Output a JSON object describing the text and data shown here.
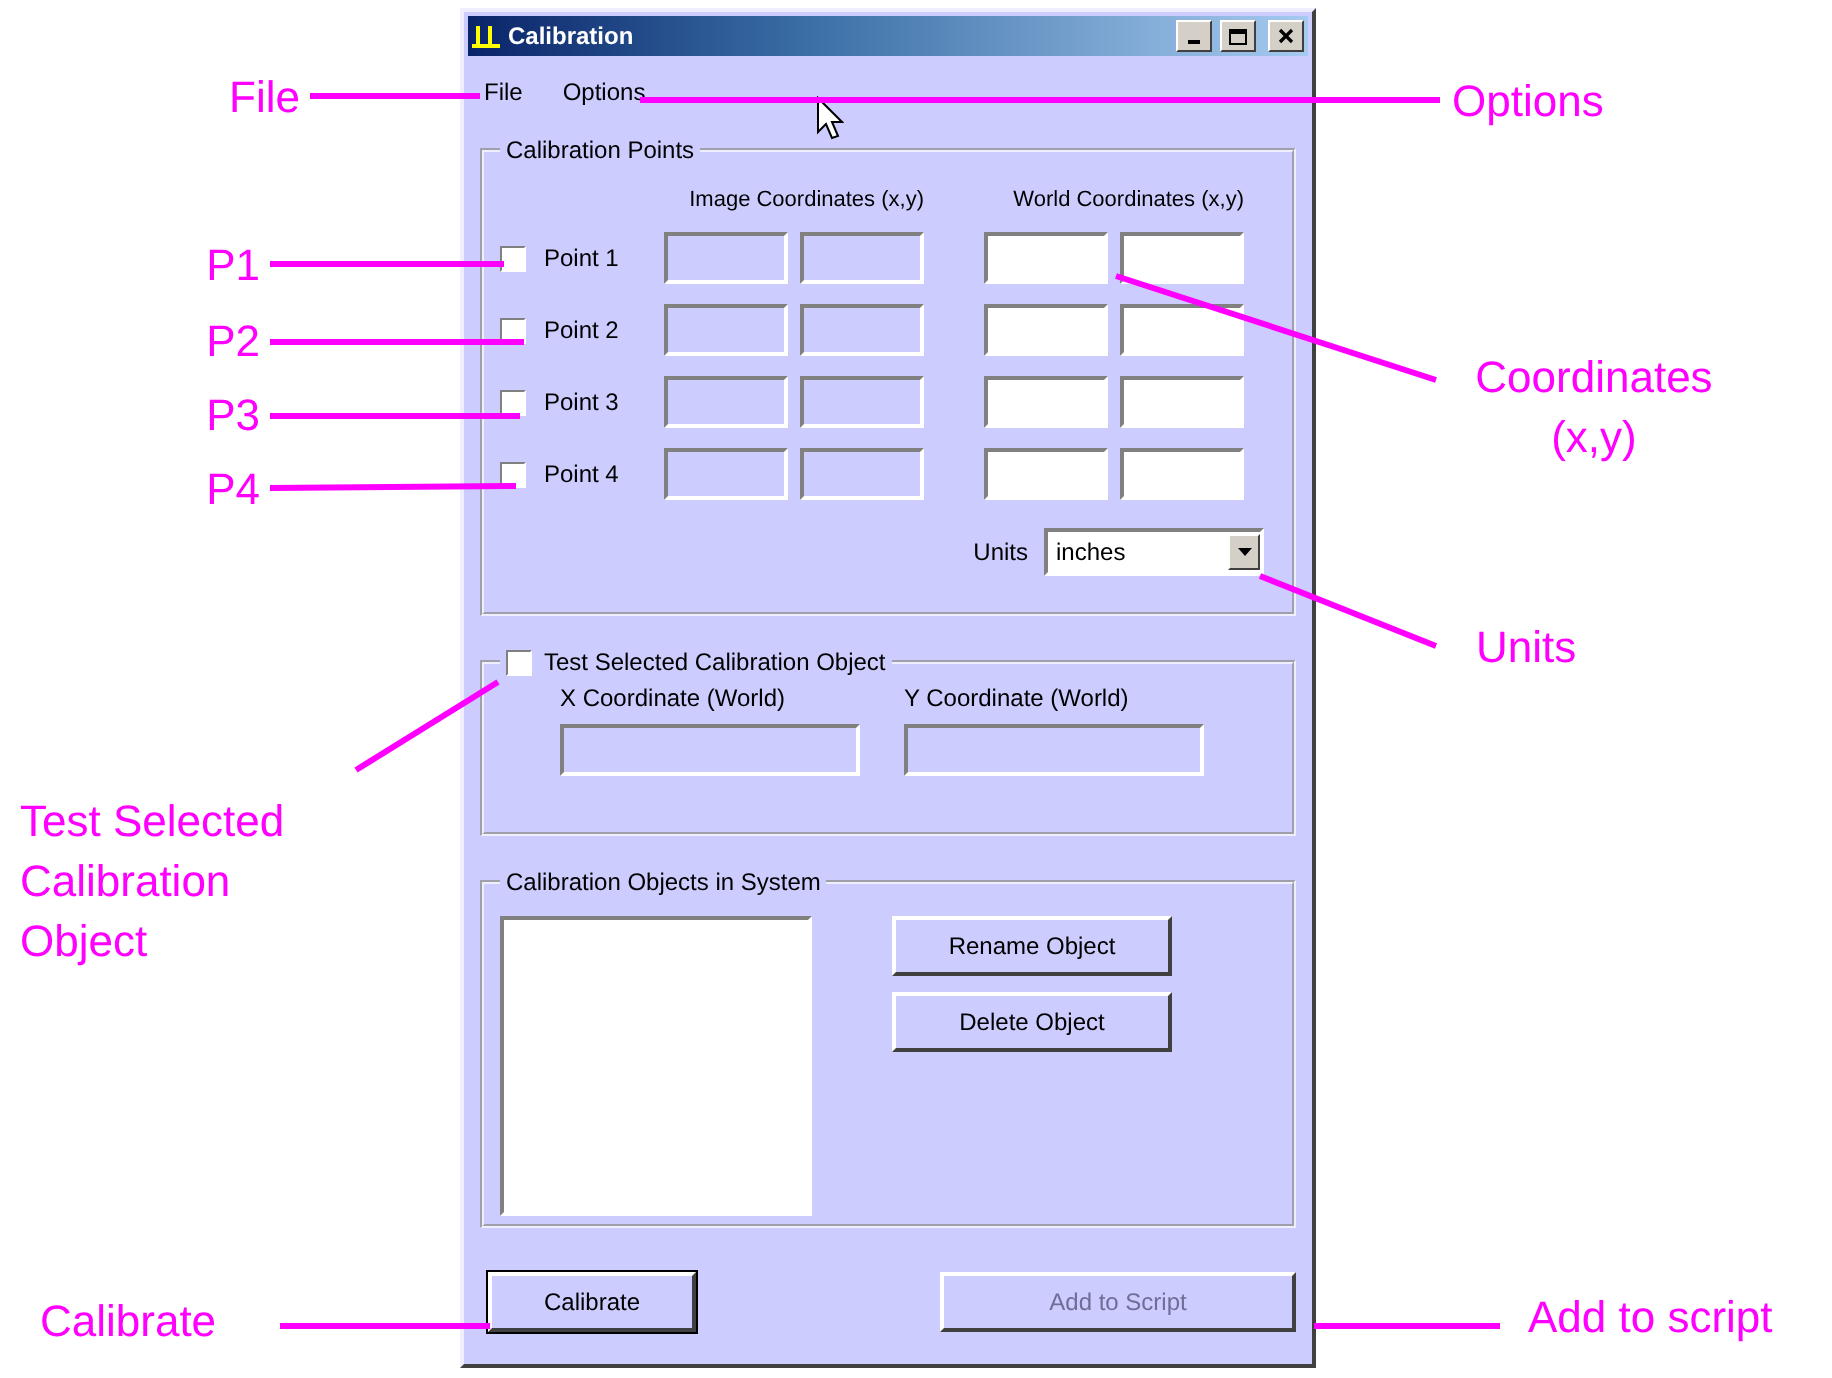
{
  "window": {
    "title": "Calibration"
  },
  "menu": [
    {
      "label": "File"
    },
    {
      "label": "Options"
    }
  ],
  "calibration_points": {
    "title": "Calibration Points",
    "image_header": "Image Coordinates (x,y)",
    "world_header": "World Coordinates (x,y)",
    "image_disabled": true,
    "world_disabled": false,
    "points": [
      {
        "label": "Point 1",
        "checked": false
      },
      {
        "label": "Point 2",
        "checked": false
      },
      {
        "label": "Point 3",
        "checked": false
      },
      {
        "label": "Point 4",
        "checked": false
      }
    ],
    "units_label": "Units",
    "units_value": "inches"
  },
  "test_object": {
    "label": "Test Selected Calibration Object",
    "checked": false,
    "x_label": "X Coordinate (World)",
    "y_label": "Y Coordinate (World)",
    "fields_disabled": true
  },
  "objects": {
    "title": "Calibration Objects in System",
    "buttons": [
      "Rename Object",
      "Delete Object"
    ]
  },
  "footer_buttons": [
    {
      "label": "Calibrate",
      "disabled": false
    },
    {
      "label": "Add to Script",
      "disabled": true
    }
  ],
  "annotations": [
    {
      "text": "File"
    },
    {
      "text": "Options"
    },
    {
      "text": "P1"
    },
    {
      "text": "P2"
    },
    {
      "text": "P3"
    },
    {
      "text": "P4"
    },
    {
      "text": "Coordinates (x,y)"
    },
    {
      "text": "Units"
    },
    {
      "text": "Test Selected Calibration Object"
    },
    {
      "text": "Calibrate"
    },
    {
      "text": "Add to script"
    }
  ]
}
